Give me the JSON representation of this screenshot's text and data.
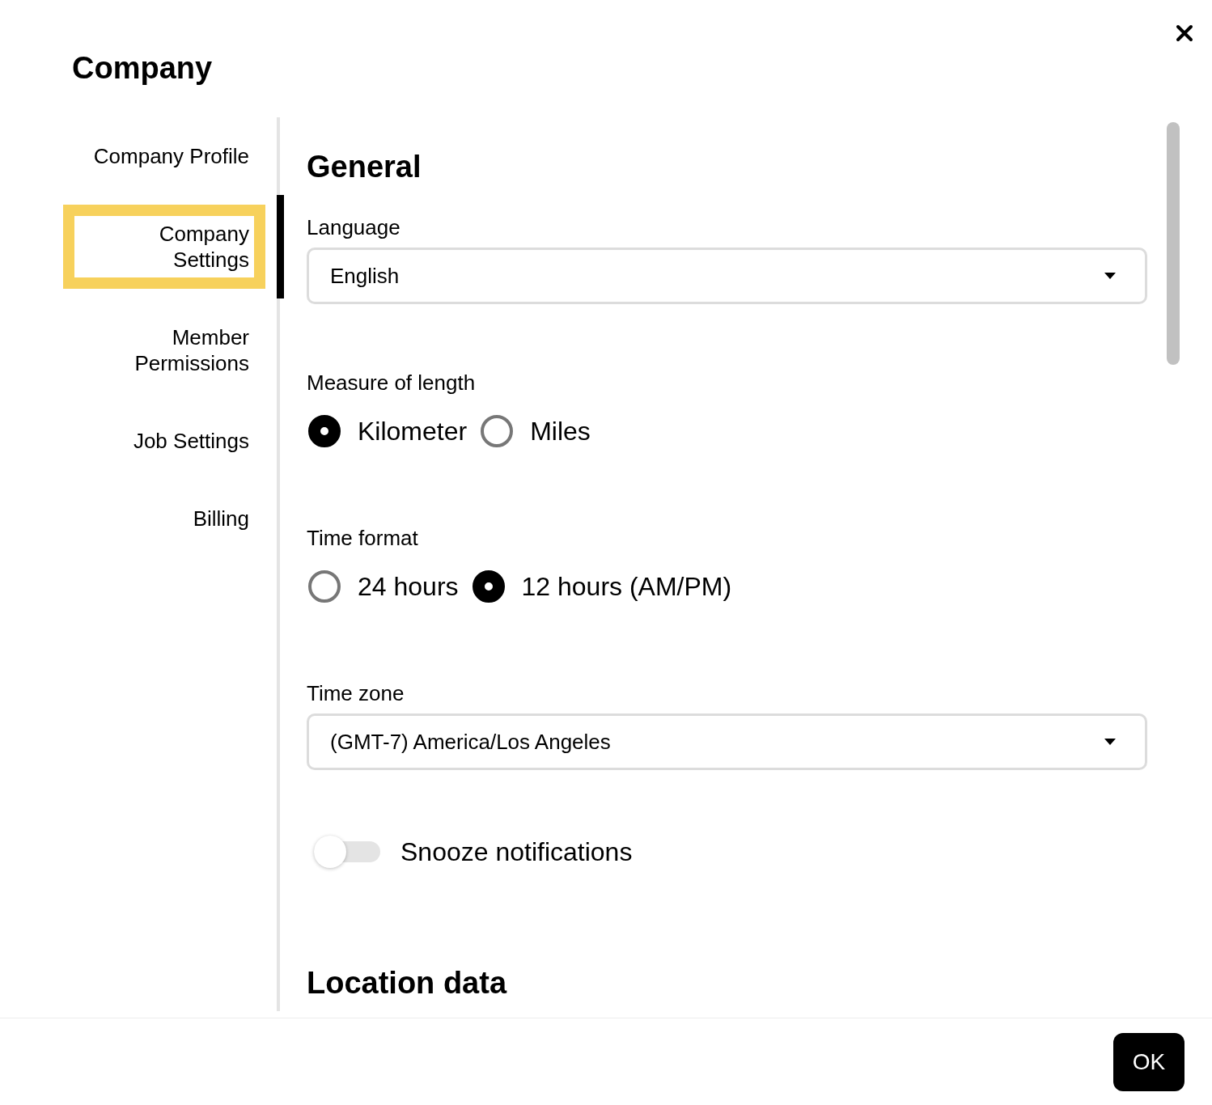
{
  "dialog": {
    "title": "Company"
  },
  "sidebar": {
    "items": [
      {
        "label": "Company Profile",
        "selected": false
      },
      {
        "label": "Company Settings",
        "selected": true
      },
      {
        "label": "Member Permissions",
        "selected": false
      },
      {
        "label": "Job Settings",
        "selected": false
      },
      {
        "label": "Billing",
        "selected": false
      }
    ]
  },
  "content": {
    "sections": [
      {
        "heading": "General",
        "fields": [
          {
            "kind": "select",
            "label": "Language",
            "value": "English"
          },
          {
            "kind": "radio",
            "label": "Measure of length",
            "options": [
              {
                "label": "Kilometer",
                "selected": true
              },
              {
                "label": "Miles",
                "selected": false
              }
            ]
          },
          {
            "kind": "radio",
            "label": "Time format",
            "options": [
              {
                "label": "24 hours",
                "selected": false
              },
              {
                "label": "12 hours (AM/PM)",
                "selected": true
              }
            ]
          },
          {
            "kind": "select",
            "label": "Time zone",
            "value": "(GMT-7) America/Los Angeles"
          },
          {
            "kind": "toggle",
            "label": "Snooze notifications",
            "on": false
          }
        ]
      },
      {
        "heading": "Location data"
      }
    ]
  },
  "footer": {
    "button": "OK"
  }
}
